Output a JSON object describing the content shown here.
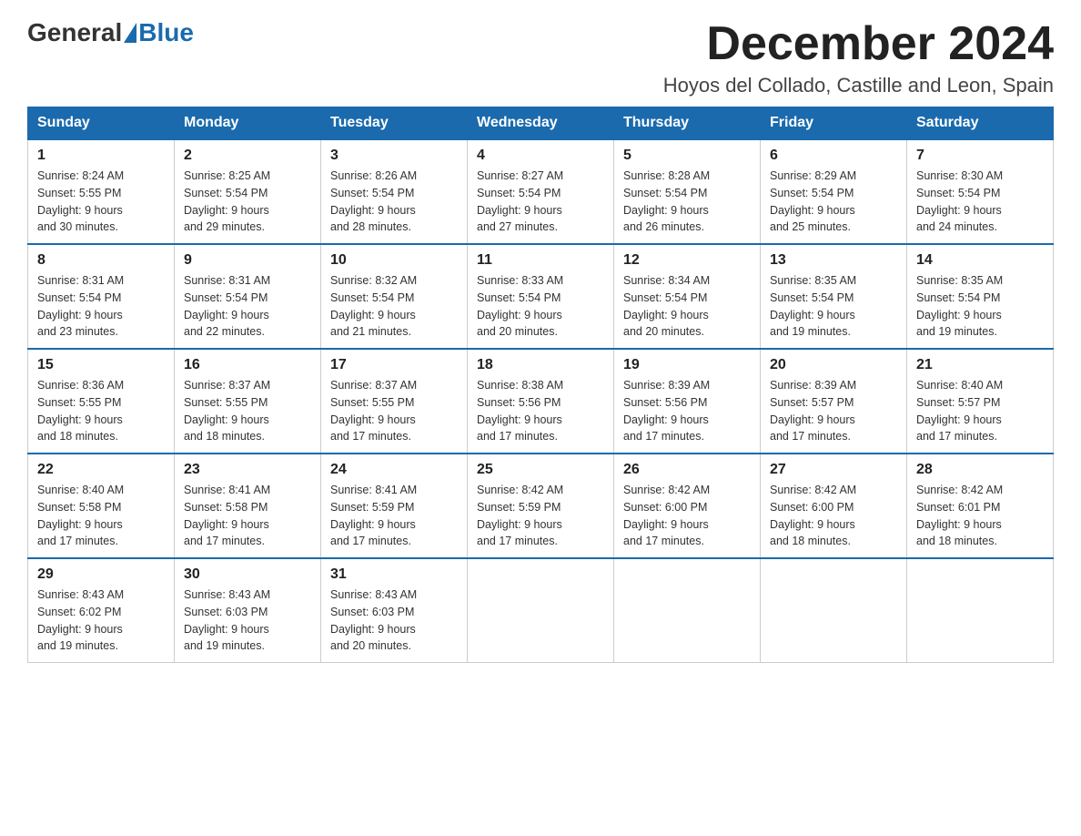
{
  "header": {
    "logo_general": "General",
    "logo_blue": "Blue",
    "month_year": "December 2024",
    "location": "Hoyos del Collado, Castille and Leon, Spain"
  },
  "days_of_week": [
    "Sunday",
    "Monday",
    "Tuesday",
    "Wednesday",
    "Thursday",
    "Friday",
    "Saturday"
  ],
  "weeks": [
    [
      {
        "day": "1",
        "sunrise": "8:24 AM",
        "sunset": "5:55 PM",
        "daylight": "9 hours and 30 minutes."
      },
      {
        "day": "2",
        "sunrise": "8:25 AM",
        "sunset": "5:54 PM",
        "daylight": "9 hours and 29 minutes."
      },
      {
        "day": "3",
        "sunrise": "8:26 AM",
        "sunset": "5:54 PM",
        "daylight": "9 hours and 28 minutes."
      },
      {
        "day": "4",
        "sunrise": "8:27 AM",
        "sunset": "5:54 PM",
        "daylight": "9 hours and 27 minutes."
      },
      {
        "day": "5",
        "sunrise": "8:28 AM",
        "sunset": "5:54 PM",
        "daylight": "9 hours and 26 minutes."
      },
      {
        "day": "6",
        "sunrise": "8:29 AM",
        "sunset": "5:54 PM",
        "daylight": "9 hours and 25 minutes."
      },
      {
        "day": "7",
        "sunrise": "8:30 AM",
        "sunset": "5:54 PM",
        "daylight": "9 hours and 24 minutes."
      }
    ],
    [
      {
        "day": "8",
        "sunrise": "8:31 AM",
        "sunset": "5:54 PM",
        "daylight": "9 hours and 23 minutes."
      },
      {
        "day": "9",
        "sunrise": "8:31 AM",
        "sunset": "5:54 PM",
        "daylight": "9 hours and 22 minutes."
      },
      {
        "day": "10",
        "sunrise": "8:32 AM",
        "sunset": "5:54 PM",
        "daylight": "9 hours and 21 minutes."
      },
      {
        "day": "11",
        "sunrise": "8:33 AM",
        "sunset": "5:54 PM",
        "daylight": "9 hours and 20 minutes."
      },
      {
        "day": "12",
        "sunrise": "8:34 AM",
        "sunset": "5:54 PM",
        "daylight": "9 hours and 20 minutes."
      },
      {
        "day": "13",
        "sunrise": "8:35 AM",
        "sunset": "5:54 PM",
        "daylight": "9 hours and 19 minutes."
      },
      {
        "day": "14",
        "sunrise": "8:35 AM",
        "sunset": "5:54 PM",
        "daylight": "9 hours and 19 minutes."
      }
    ],
    [
      {
        "day": "15",
        "sunrise": "8:36 AM",
        "sunset": "5:55 PM",
        "daylight": "9 hours and 18 minutes."
      },
      {
        "day": "16",
        "sunrise": "8:37 AM",
        "sunset": "5:55 PM",
        "daylight": "9 hours and 18 minutes."
      },
      {
        "day": "17",
        "sunrise": "8:37 AM",
        "sunset": "5:55 PM",
        "daylight": "9 hours and 17 minutes."
      },
      {
        "day": "18",
        "sunrise": "8:38 AM",
        "sunset": "5:56 PM",
        "daylight": "9 hours and 17 minutes."
      },
      {
        "day": "19",
        "sunrise": "8:39 AM",
        "sunset": "5:56 PM",
        "daylight": "9 hours and 17 minutes."
      },
      {
        "day": "20",
        "sunrise": "8:39 AM",
        "sunset": "5:57 PM",
        "daylight": "9 hours and 17 minutes."
      },
      {
        "day": "21",
        "sunrise": "8:40 AM",
        "sunset": "5:57 PM",
        "daylight": "9 hours and 17 minutes."
      }
    ],
    [
      {
        "day": "22",
        "sunrise": "8:40 AM",
        "sunset": "5:58 PM",
        "daylight": "9 hours and 17 minutes."
      },
      {
        "day": "23",
        "sunrise": "8:41 AM",
        "sunset": "5:58 PM",
        "daylight": "9 hours and 17 minutes."
      },
      {
        "day": "24",
        "sunrise": "8:41 AM",
        "sunset": "5:59 PM",
        "daylight": "9 hours and 17 minutes."
      },
      {
        "day": "25",
        "sunrise": "8:42 AM",
        "sunset": "5:59 PM",
        "daylight": "9 hours and 17 minutes."
      },
      {
        "day": "26",
        "sunrise": "8:42 AM",
        "sunset": "6:00 PM",
        "daylight": "9 hours and 17 minutes."
      },
      {
        "day": "27",
        "sunrise": "8:42 AM",
        "sunset": "6:00 PM",
        "daylight": "9 hours and 18 minutes."
      },
      {
        "day": "28",
        "sunrise": "8:42 AM",
        "sunset": "6:01 PM",
        "daylight": "9 hours and 18 minutes."
      }
    ],
    [
      {
        "day": "29",
        "sunrise": "8:43 AM",
        "sunset": "6:02 PM",
        "daylight": "9 hours and 19 minutes."
      },
      {
        "day": "30",
        "sunrise": "8:43 AM",
        "sunset": "6:03 PM",
        "daylight": "9 hours and 19 minutes."
      },
      {
        "day": "31",
        "sunrise": "8:43 AM",
        "sunset": "6:03 PM",
        "daylight": "9 hours and 20 minutes."
      },
      null,
      null,
      null,
      null
    ]
  ],
  "labels": {
    "sunrise": "Sunrise:",
    "sunset": "Sunset:",
    "daylight": "Daylight:"
  },
  "colors": {
    "header_bg": "#1a6aad",
    "header_text": "#ffffff",
    "border": "#1a6aad"
  }
}
